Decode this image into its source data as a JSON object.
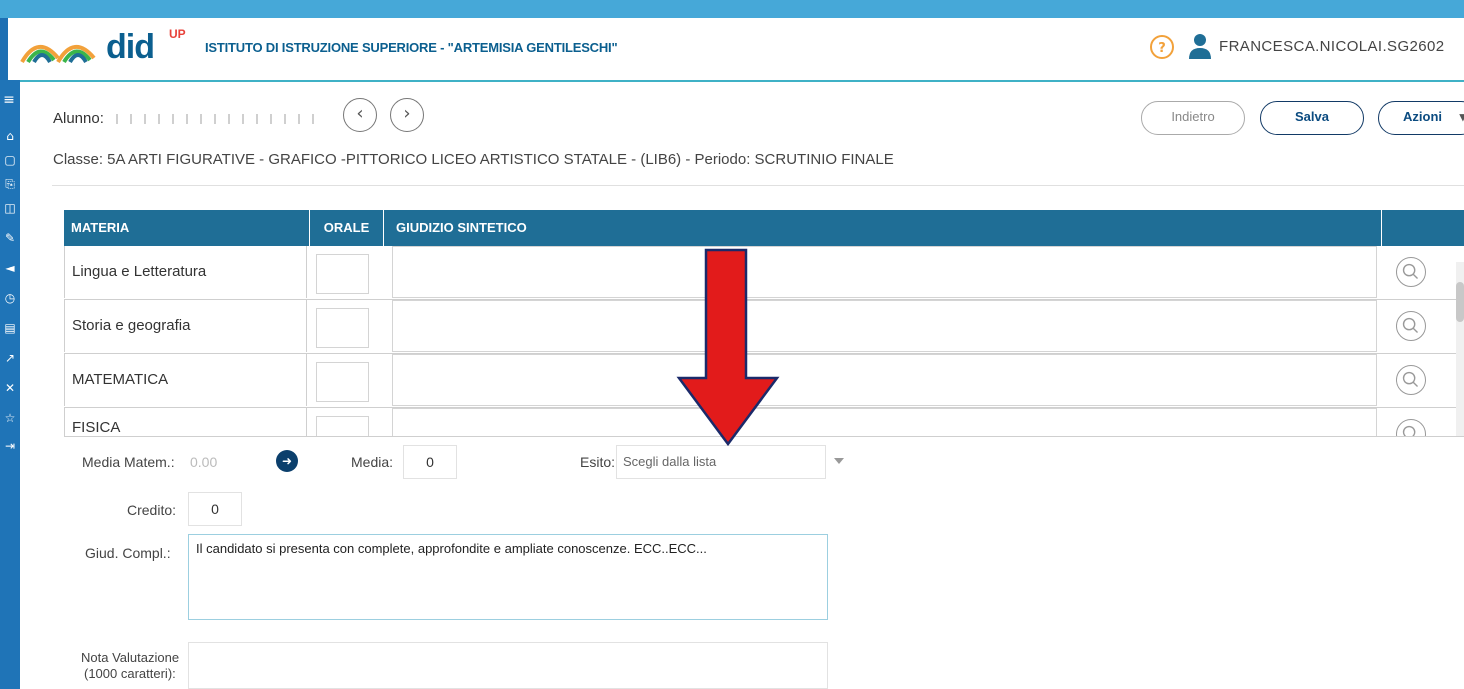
{
  "header": {
    "logo_text": "did",
    "logo_super": "UP",
    "school_name": "ISTITUTO DI ISTRUZIONE SUPERIORE - \"ARTEMISIA GENTILESCHI\"",
    "help_label": "?",
    "username": "FRANCESCA.NICOLAI.SG2602"
  },
  "sidenav": {
    "items": [
      "menu-icon",
      "home-icon",
      "calendar-icon",
      "register-icon",
      "book-icon",
      "grades-icon",
      "megaphone-icon",
      "clock-icon",
      "printer-icon",
      "share-icon",
      "tools-icon",
      "star-icon",
      "exit-icon"
    ]
  },
  "student": {
    "label": "Alunno:",
    "class_line": "Classe: 5A ARTI FIGURATIVE - GRAFICO -PITTORICO LICEO ARTISTICO STATALE - (LIB6) - Periodo: SCRUTINIO FINALE"
  },
  "toolbar": {
    "prev": "‹",
    "next": "›",
    "back_label": "Indietro",
    "save_label": "Salva",
    "actions_label": "Azioni",
    "actions_caret": "▾"
  },
  "table": {
    "headers": [
      "MATERIA",
      "ORALE",
      "GIUDIZIO SINTETICO",
      ""
    ],
    "rows": [
      {
        "materia": "Lingua e Letteratura"
      },
      {
        "materia": "Storia e geografia"
      },
      {
        "materia": "MATEMATICA"
      },
      {
        "materia": "FISICA"
      }
    ]
  },
  "form": {
    "media_matem_label": "Media Matem.:",
    "media_matem_value": "0.00",
    "media_label": "Media:",
    "media_value": "0",
    "esito_label": "Esito:",
    "esito_placeholder": "Scegli dalla lista",
    "credito_label": "Credito:",
    "credito_value": "0",
    "giud_label": "Giud. Compl.:",
    "giud_value": "Il candidato si presenta con complete, approfondite e ampliate conoscenze. ECC..ECC...",
    "nota_label_1": "Nota Valutazione",
    "nota_label_2": "(1000 caratteri):"
  },
  "colors": {
    "header_teal": "#1f6e96",
    "brand_blue": "#0b5f8f",
    "annotation_red": "#e21b1b"
  }
}
